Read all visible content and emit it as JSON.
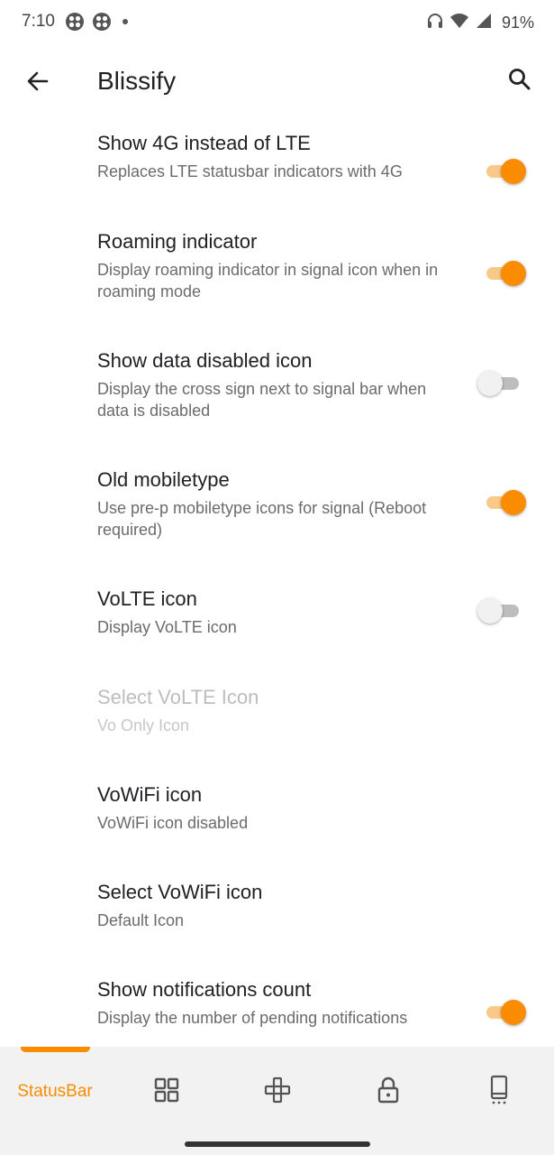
{
  "status_bar": {
    "time": "7:10",
    "battery": "91%",
    "icons": [
      "app-notification-icon",
      "app-notification-icon",
      "dot-icon",
      "headset-icon",
      "wifi-icon",
      "signal-icon"
    ]
  },
  "app_bar": {
    "title": "Blissify",
    "back_icon": "arrow-back-icon",
    "search_icon": "search-icon"
  },
  "accent_color": "#fb8c00",
  "preferences": [
    {
      "title": "Show 4G instead of LTE",
      "summary": "Replaces LTE statusbar indicators with 4G",
      "switch": true,
      "checked": true,
      "enabled": true
    },
    {
      "title": "Roaming indicator",
      "summary": "Display roaming indicator in signal icon when in roaming mode",
      "switch": true,
      "checked": true,
      "enabled": true
    },
    {
      "title": "Show data disabled icon",
      "summary": "Display the cross sign next to signal bar when data is disabled",
      "switch": true,
      "checked": false,
      "enabled": true
    },
    {
      "title": "Old mobiletype",
      "summary": "Use pre-p mobiletype icons for signal (Reboot required)",
      "switch": true,
      "checked": true,
      "enabled": true
    },
    {
      "title": "VoLTE icon",
      "summary": "Display VoLTE icon",
      "switch": true,
      "checked": false,
      "enabled": true
    },
    {
      "title": "Select VoLTE Icon",
      "summary": "Vo Only Icon",
      "switch": false,
      "enabled": false
    },
    {
      "title": "VoWiFi icon",
      "summary": "VoWiFi icon disabled",
      "switch": false,
      "enabled": true
    },
    {
      "title": "Select VoWiFi icon",
      "summary": "Default Icon",
      "switch": false,
      "enabled": true
    },
    {
      "title": "Show notifications count",
      "summary": "Display the number of pending notifications",
      "switch": true,
      "checked": true,
      "enabled": true
    }
  ],
  "bottom_nav": {
    "active_label": "StatusBar",
    "items": [
      "statusbar-tab",
      "grid-icon",
      "gamepad-icon",
      "lock-icon",
      "phone-icon"
    ]
  }
}
